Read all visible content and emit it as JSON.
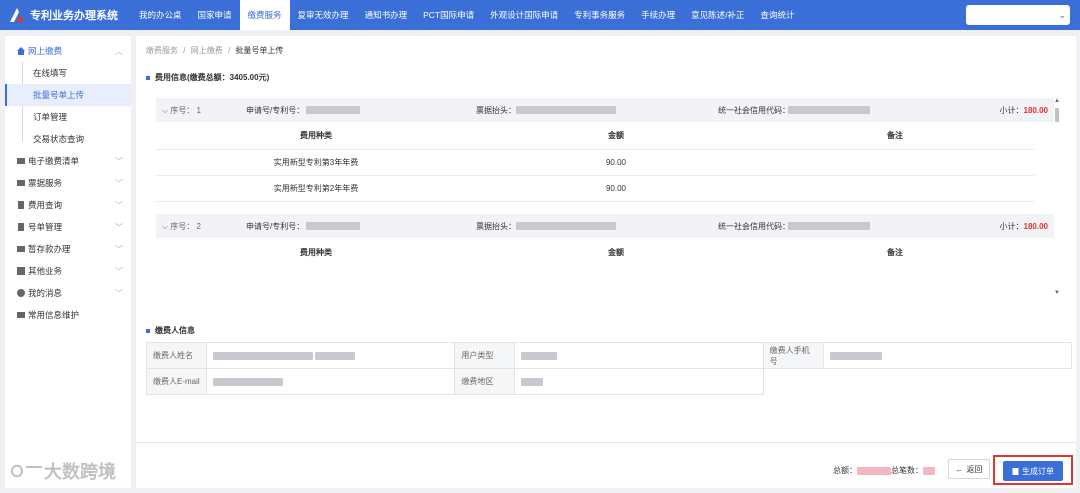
{
  "app": {
    "title": "专利业务办理系统"
  },
  "nav": [
    {
      "label": "我的办公桌"
    },
    {
      "label": "国家申请"
    },
    {
      "label": "缴费服务",
      "active": true
    },
    {
      "label": "复审无效办理"
    },
    {
      "label": "通知书办理"
    },
    {
      "label": "PCT国际申请"
    },
    {
      "label": "外观设计国际申请"
    },
    {
      "label": "专利事务服务"
    },
    {
      "label": "手续办理"
    },
    {
      "label": "意见陈述/补正"
    },
    {
      "label": "查询统计"
    }
  ],
  "sidebar": {
    "online_pay": {
      "label": "网上缴费",
      "subs": [
        {
          "label": "在线填写"
        },
        {
          "label": "批量号单上传",
          "active": true
        },
        {
          "label": "订单管理"
        },
        {
          "label": "交易状态查询"
        }
      ]
    },
    "groups": [
      {
        "label": "电子缴费清单"
      },
      {
        "label": "票据服务"
      },
      {
        "label": "费用查询"
      },
      {
        "label": "号单管理"
      },
      {
        "label": "暂存款办理"
      },
      {
        "label": "其他业务"
      },
      {
        "label": "我的消息"
      },
      {
        "label": "常用信息维护"
      }
    ]
  },
  "breadcrumb": {
    "a": "缴费服务",
    "b": "网上缴费",
    "c": "批量号单上传",
    "sep": "/"
  },
  "fee_info": {
    "title": "费用信息(缴费总额：3405.00元)",
    "labels": {
      "app_no": "申请号/专利号：",
      "invoice": "票据抬头：",
      "credit": "统一社会信用代码：",
      "subtotal": "小计：",
      "fee_type": "费用种类",
      "amount": "金额",
      "note": "备注"
    },
    "items": [
      {
        "seq": "序号： 1",
        "subtotal": "180.00",
        "rows": [
          {
            "type": "实用新型专利第3年年费",
            "amount": "90.00"
          },
          {
            "type": "实用新型专利第2年年费",
            "amount": "90.00"
          }
        ]
      },
      {
        "seq": "序号： 2",
        "subtotal": "180.00"
      }
    ]
  },
  "payer_info": {
    "title": "缴费人信息",
    "name_label": "缴费人姓名",
    "user_type_label": "用户类型",
    "phone_label": "缴费人手机号",
    "email_label": "缴费人E-mail",
    "region_label": "缴费地区"
  },
  "footer": {
    "total_label": "总额：",
    "count_label": "总笔数：",
    "back": "返回",
    "generate": "生成订单"
  },
  "watermark": {
    "text": "大数跨境"
  },
  "colors": {
    "primary": "#3a6fd8",
    "danger": "#e0362c"
  }
}
